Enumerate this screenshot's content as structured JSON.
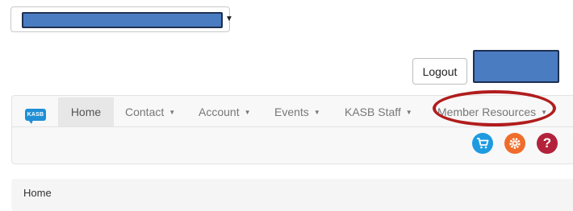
{
  "org_select": {
    "value_redacted": true
  },
  "header": {
    "logout_label": "Logout",
    "user_redacted": true
  },
  "nav": {
    "brand": "KASB",
    "items": [
      {
        "label": "Home",
        "active": true,
        "dropdown": false
      },
      {
        "label": "Contact",
        "dropdown": true
      },
      {
        "label": "Account",
        "dropdown": true
      },
      {
        "label": "Events",
        "dropdown": true
      },
      {
        "label": "KASB Staff",
        "dropdown": true
      },
      {
        "label": "Member Resources",
        "dropdown": true,
        "highlighted": true
      }
    ],
    "icons": [
      "cart-icon",
      "settings-icon",
      "help-icon"
    ]
  },
  "breadcrumb": {
    "current": "Home"
  },
  "colors": {
    "redaction": "#4a7cc2",
    "highlight": "#b11d1d",
    "cart": "#1e9be0",
    "settings": "#ef6c2a",
    "help": "#b3223a"
  }
}
